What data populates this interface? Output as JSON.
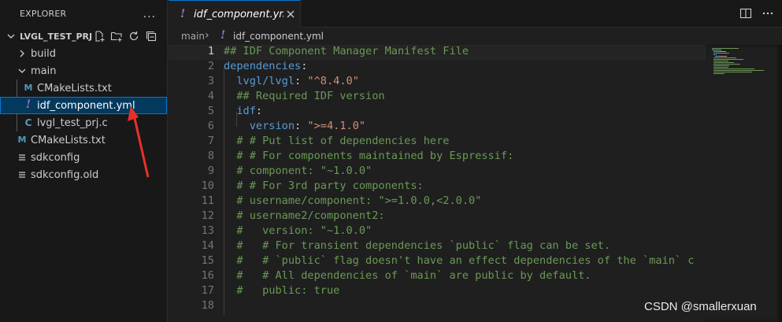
{
  "explorer": {
    "title": "EXPLORER",
    "more_label": "...",
    "folder_name": "LVGL_TEST_PRJ",
    "items": [
      {
        "label": "build",
        "icon": "chevron-right-icon"
      },
      {
        "label": "main",
        "icon": "chevron-down-icon"
      },
      {
        "label": "CMakeLists.txt",
        "icon": "cmake-file-icon",
        "glyph": "M"
      },
      {
        "label": "idf_component.yml",
        "icon": "yaml-file-icon",
        "glyph": "!"
      },
      {
        "label": "lvgl_test_prj.c",
        "icon": "c-file-icon",
        "glyph": "C"
      },
      {
        "label": "CMakeLists.txt",
        "icon": "cmake-file-icon",
        "glyph": "M"
      },
      {
        "label": "sdkconfig",
        "icon": "settings-lines-icon"
      },
      {
        "label": "sdkconfig.old",
        "icon": "settings-lines-icon"
      }
    ]
  },
  "tab": {
    "label": "idf_component.yml",
    "glyph": "!"
  },
  "breadcrumb": {
    "folder": "main",
    "separator": "›",
    "glyph": "!",
    "file": "idf_component.yml"
  },
  "editor": {
    "line_numbers": [
      "1",
      "2",
      "3",
      "4",
      "5",
      "6",
      "7",
      "8",
      "9",
      "10",
      "11",
      "12",
      "13",
      "14",
      "15",
      "16",
      "17",
      "18"
    ],
    "current_line": 1,
    "lines": [
      [
        {
          "t": "## IDF Component Manager Manifest File",
          "c": "cmt"
        }
      ],
      [
        {
          "t": "dependencies",
          "c": "key"
        },
        {
          "t": ":",
          "c": "pun"
        }
      ],
      [
        {
          "t": "  lvgl/lvgl",
          "c": "key"
        },
        {
          "t": ": ",
          "c": "pun"
        },
        {
          "t": "\"^8.4.0\"",
          "c": "str"
        }
      ],
      [
        {
          "t": "  ## Required IDF version",
          "c": "cmt"
        }
      ],
      [
        {
          "t": "  idf",
          "c": "key"
        },
        {
          "t": ":",
          "c": "pun"
        }
      ],
      [
        {
          "t": "    version",
          "c": "key"
        },
        {
          "t": ": ",
          "c": "pun"
        },
        {
          "t": "\">=4.1.0\"",
          "c": "str"
        }
      ],
      [
        {
          "t": "  # # Put list of dependencies here",
          "c": "cmt"
        }
      ],
      [
        {
          "t": "  # # For components maintained by Espressif:",
          "c": "cmt"
        }
      ],
      [
        {
          "t": "  # component: \"~1.0.0\"",
          "c": "cmt"
        }
      ],
      [
        {
          "t": "  # # For 3rd party components:",
          "c": "cmt"
        }
      ],
      [
        {
          "t": "  # username/component: \">=1.0.0,<2.0.0\"",
          "c": "cmt"
        }
      ],
      [
        {
          "t": "  # username2/component2:",
          "c": "cmt"
        }
      ],
      [
        {
          "t": "  #   version: \"~1.0.0\"",
          "c": "cmt"
        }
      ],
      [
        {
          "t": "  #   # For transient dependencies `public` flag can be set.",
          "c": "cmt"
        }
      ],
      [
        {
          "t": "  #   # `public` flag doesn't have an effect dependencies of the `main` c",
          "c": "cmt"
        }
      ],
      [
        {
          "t": "  #   # All dependencies of `main` are public by default.",
          "c": "cmt"
        }
      ],
      [
        {
          "t": "  #   public: true",
          "c": "cmt"
        }
      ],
      [
        {
          "t": "",
          "c": "pun"
        }
      ]
    ]
  },
  "watermark": "CSDN @smallerxuan",
  "colors": {
    "accent": "#0078d4",
    "selection": "#04395e",
    "comment": "#6a9955",
    "keyword": "#569cd6",
    "string": "#ce9178",
    "annotation_arrow": "#e8302a"
  }
}
